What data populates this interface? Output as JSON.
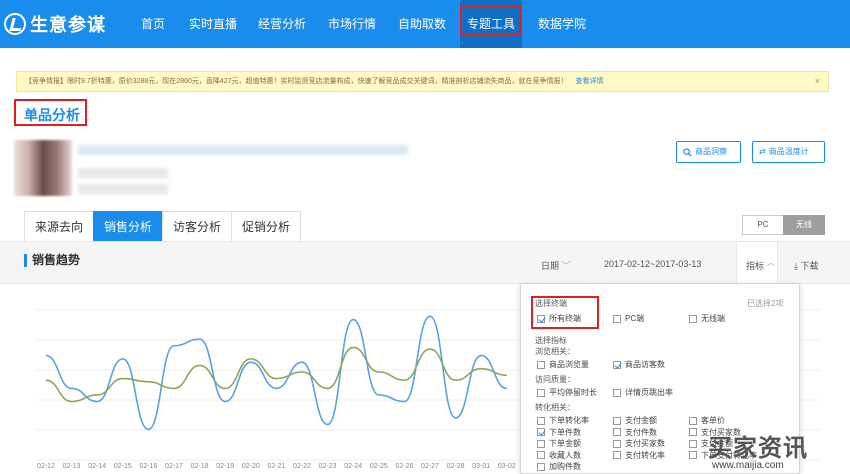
{
  "nav": {
    "logo": "生意参谋",
    "items": [
      "首页",
      "实时直播",
      "经营分析",
      "市场行情",
      "自助取数",
      "专题工具",
      "数据学院"
    ],
    "active_index": 5
  },
  "notice": {
    "text": "【竞争情报】限时9.7折特惠，原价3288元，现在2860元，直降427元，超值特惠！实时监测竞店流量构成，快速了解竞品成交关键词，精准剖析店铺流失商品，就在竞争情报！",
    "link": "查看详情",
    "close": "×"
  },
  "page_title": "单品分析",
  "actions": {
    "search_product": "商品洞察",
    "product_tempo": "商品温度计"
  },
  "tabs": [
    "来源去向",
    "销售分析",
    "访客分析",
    "促销分析"
  ],
  "active_tab": 1,
  "device_toggle": {
    "pc": "PC",
    "wireless": "无线",
    "selected": "wireless"
  },
  "section": {
    "title": "销售趋势",
    "date_label": "日期",
    "date_range": "2017-02-12~2017-03-13",
    "metric_label": "指标",
    "download": "下载"
  },
  "dropdown": {
    "terminal_title": "选择终端",
    "selected_count": "已选择2项",
    "terminals": [
      {
        "label": "所有终端",
        "checked": true
      },
      {
        "label": "PC端",
        "checked": false
      },
      {
        "label": "无线端",
        "checked": false
      }
    ],
    "metric_title": "选择指标",
    "groups": [
      {
        "name": "浏览相关：",
        "items": [
          {
            "label": "商品浏览量",
            "checked": false
          },
          {
            "label": "商品访客数",
            "checked": true
          }
        ]
      },
      {
        "name": "访问质量：",
        "items": [
          {
            "label": "平均停留时长",
            "checked": false
          },
          {
            "label": "详情页跳出率",
            "checked": false
          }
        ]
      },
      {
        "name": "转化相关：",
        "items": [
          {
            "label": "下单转化率",
            "checked": false
          },
          {
            "label": "支付金额",
            "checked": false
          },
          {
            "label": "客单价",
            "checked": false
          },
          {
            "label": "下单件数",
            "checked": true
          },
          {
            "label": "支付件数",
            "checked": false
          },
          {
            "label": "支付买家数",
            "checked": false
          },
          {
            "label": "下单金额",
            "checked": false
          },
          {
            "label": "支付买家数",
            "checked": false
          },
          {
            "label": "支付金额",
            "checked": false
          },
          {
            "label": "收藏人数",
            "checked": false
          },
          {
            "label": "支付转化率",
            "checked": false
          },
          {
            "label": "下单支付转化率",
            "checked": false
          },
          {
            "label": "加购件数",
            "checked": false
          }
        ]
      }
    ]
  },
  "chart_data": {
    "type": "line",
    "x": [
      "02-12",
      "02-13",
      "02-14",
      "02-15",
      "02-16",
      "02-17",
      "02-18",
      "02-19",
      "02-20",
      "02-21",
      "02-22",
      "02-23",
      "02-24",
      "02-25",
      "02-26",
      "02-27",
      "02-28",
      "03-01",
      "03-02"
    ],
    "series": [
      {
        "color": "#5aa0e8",
        "values": [
          6.0,
          4.0,
          3.2,
          5.8,
          1.5,
          6.6,
          7.0,
          3.2,
          5.6,
          4.0,
          5.6,
          1.8,
          8.2,
          3.6,
          3.2,
          8.4,
          2.2,
          6.0,
          4.0
        ]
      },
      {
        "color": "#8aa85a",
        "values": [
          4.5,
          3.2,
          3.6,
          4.6,
          4.4,
          4.0,
          5.4,
          4.0,
          5.8,
          4.6,
          5.0,
          4.0,
          6.5,
          5.0,
          4.5,
          6.4,
          4.5,
          5.2,
          4.8
        ]
      }
    ],
    "ylim": [
      0,
      10
    ],
    "grid": true
  },
  "watermark": {
    "main": "买家资讯",
    "sub": "www.maijia.com"
  },
  "colors": {
    "primary": "#1a8ceb",
    "highlight": "#e02020",
    "notice_bg": "#fff9c4"
  }
}
